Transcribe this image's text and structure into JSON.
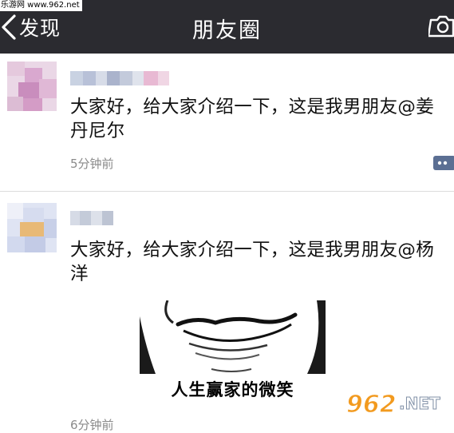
{
  "watermark": {
    "top_text": "乐游网 www.962.net",
    "logo_number": "962",
    "logo_domain": ".NET",
    "logo_name": "乐游网"
  },
  "navbar": {
    "back_label": "发现",
    "title": "朋友圈"
  },
  "posts": [
    {
      "text": "大家好，给大家介绍一下，这是我男朋友@姜丹尼尔",
      "time": "5分钟前"
    },
    {
      "text": "大家好，给大家介绍一下，这是我男朋友@杨洋",
      "time": "6分钟前",
      "image_caption": "人生赢家的微笑"
    }
  ],
  "colors": {
    "navbar_bg": "#2b2b30",
    "text": "#111111",
    "time": "#8a8a8a",
    "comment_btn": "#5b6f93"
  }
}
